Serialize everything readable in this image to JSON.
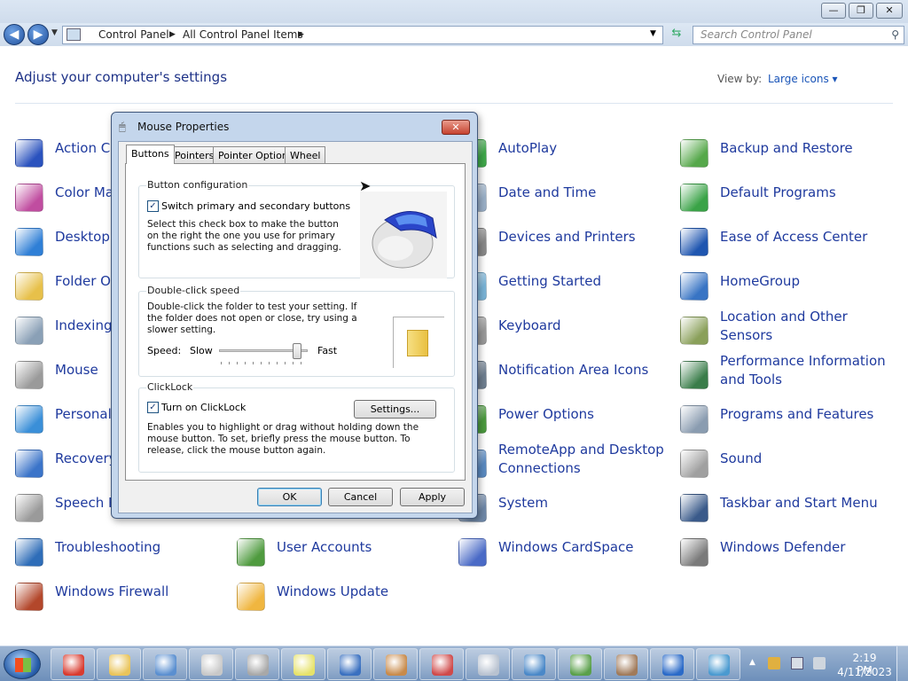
{
  "window": {
    "caption_min": "—",
    "caption_max": "❐",
    "caption_close": "✕"
  },
  "address": {
    "crumbs": [
      "Control Panel",
      "All Control Panel Items"
    ],
    "search_placeholder": "Search Control Panel"
  },
  "main": {
    "heading": "Adjust your computer's settings",
    "view_by_label": "View by:",
    "view_by_value": "Large icons ▾"
  },
  "items": {
    "col1": [
      {
        "label": "Action Ce",
        "color": "#2a52be"
      },
      {
        "label": "Color Ma",
        "color": "#c04da0"
      },
      {
        "label": "Desktop",
        "color": "#2f7fd6"
      },
      {
        "label": "Folder Op",
        "color": "#e7c04a"
      },
      {
        "label": "Indexing",
        "color": "#8aa0b6"
      },
      {
        "label": "Mouse",
        "color": "#9a9a9a"
      },
      {
        "label": "Personali",
        "color": "#3a8fd8"
      },
      {
        "label": "Recovery",
        "color": "#3b74c9"
      },
      {
        "label": "Speech R",
        "color": "#9a9a9a"
      },
      {
        "label": "Troubleshooting",
        "color": "#2e6db8"
      },
      {
        "label": "Windows Firewall",
        "color": "#b3472b"
      }
    ],
    "col2": [
      {
        "label": "User Accounts",
        "color": "#4f9b3f"
      },
      {
        "label": "Windows Update",
        "color": "#f0b640"
      }
    ],
    "col3": [
      {
        "label": "AutoPlay",
        "color": "#3fa84a"
      },
      {
        "label": "Date and Time",
        "color": "#9ab0c8"
      },
      {
        "label": "Devices and Printers",
        "color": "#8a8a8a"
      },
      {
        "label": "Getting Started",
        "color": "#7ab4d8"
      },
      {
        "label": "Keyboard",
        "color": "#9a9a9a"
      },
      {
        "label": "Notification Area Icons",
        "color": "#6f7f90"
      },
      {
        "label": "Power Options",
        "color": "#4c9a3f"
      },
      {
        "label": "RemoteApp and Desktop Connections",
        "color": "#5b8bc2"
      },
      {
        "label": "System",
        "color": "#6f88a8"
      },
      {
        "label": "Windows CardSpace",
        "color": "#4a6ac6"
      }
    ],
    "col4": [
      {
        "label": "Backup and Restore",
        "color": "#55a84a"
      },
      {
        "label": "Default Programs",
        "color": "#3aa347"
      },
      {
        "label": "Ease of Access Center",
        "color": "#1f56b0"
      },
      {
        "label": "HomeGroup",
        "color": "#3874c4"
      },
      {
        "label": "Location and Other Sensors",
        "color": "#8aa05a"
      },
      {
        "label": "Performance Information and Tools",
        "color": "#3a7d4a"
      },
      {
        "label": "Programs and Features",
        "color": "#8a9cb0"
      },
      {
        "label": "Sound",
        "color": "#a0a0a0"
      },
      {
        "label": "Taskbar and Start Menu",
        "color": "#3a5a8a"
      },
      {
        "label": "Windows Defender",
        "color": "#7a7a7a"
      }
    ]
  },
  "dialog": {
    "title": "Mouse Properties",
    "close": "✕",
    "tabs": [
      "Buttons",
      "Pointers",
      "Pointer Options",
      "Wheel"
    ],
    "button_config": {
      "title": "Button configuration",
      "checkbox_label": "Switch primary and secondary buttons",
      "checked": "✓",
      "description": "Select this check box to make the button on the right the one you use for primary functions such as selecting and dragging."
    },
    "double_click": {
      "title": "Double-click speed",
      "description": "Double-click the folder to test your setting. If the folder does not open or close, try using a slower setting.",
      "speed_label": "Speed:",
      "slow": "Slow",
      "fast": "Fast",
      "speed_level": 0.92
    },
    "clicklock": {
      "title": "ClickLock",
      "checkbox_label": "Turn on ClickLock",
      "checked": "✓",
      "settings_button": "Settings...",
      "description": "Enables you to highlight or drag without holding down the mouse button. To set, briefly press the mouse button. To release, click the mouse button again."
    },
    "ok": "OK",
    "cancel": "Cancel",
    "apply": "Apply"
  },
  "taskbar": {
    "time": "2:19 PM",
    "date": "4/11/2023",
    "apps": [
      {
        "name": "chrome",
        "color": "#d93b2f"
      },
      {
        "name": "explorer",
        "color": "#e9c45a"
      },
      {
        "name": "control-panel",
        "color": "#5a8fd0"
      },
      {
        "name": "mouse",
        "color": "#c8c8c8"
      },
      {
        "name": "sound",
        "color": "#a8a8a8"
      },
      {
        "name": "sticky-notes",
        "color": "#e6e26a"
      },
      {
        "name": "remote-desktop",
        "color": "#3a70c0"
      },
      {
        "name": "paint",
        "color": "#c88a4a"
      },
      {
        "name": "snipping-tool",
        "color": "#d04a4a"
      },
      {
        "name": "calculator",
        "color": "#b8c2d0"
      },
      {
        "name": "photo-viewer",
        "color": "#4a88c8"
      },
      {
        "name": "chart-app",
        "color": "#5aa04a"
      },
      {
        "name": "cleanup",
        "color": "#a07a5a"
      },
      {
        "name": "internet-explorer",
        "color": "#2a6ac8"
      },
      {
        "name": "jet-app",
        "color": "#4a9ad0"
      }
    ]
  }
}
